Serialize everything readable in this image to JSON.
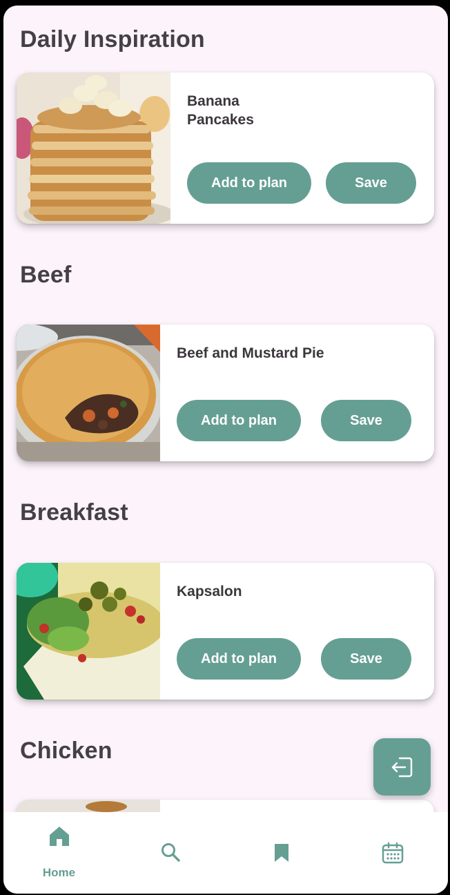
{
  "sections": [
    {
      "title": "Daily Inspiration",
      "card": {
        "title": "Banana\nPancakes",
        "add_label": "Add to plan",
        "save_label": "Save"
      }
    },
    {
      "title": "Beef",
      "card": {
        "title": "Beef and Mustard Pie",
        "add_label": "Add to plan",
        "save_label": "Save"
      }
    },
    {
      "title": "Breakfast",
      "card": {
        "title": "Kapsalon",
        "add_label": "Add to plan",
        "save_label": "Save"
      }
    },
    {
      "title": "Chicken"
    }
  ],
  "fab": {
    "icon": "logout-icon"
  },
  "bottom_nav": {
    "items": [
      {
        "icon": "home-icon",
        "label": "Home",
        "active": true
      },
      {
        "icon": "search-icon",
        "active": false
      },
      {
        "icon": "bookmark-icon",
        "active": false
      },
      {
        "icon": "calendar-icon",
        "active": false
      }
    ]
  },
  "colors": {
    "background": "#fcf3fb",
    "accent": "#659f93",
    "title_text": "#454047",
    "card": "#ffffff"
  }
}
